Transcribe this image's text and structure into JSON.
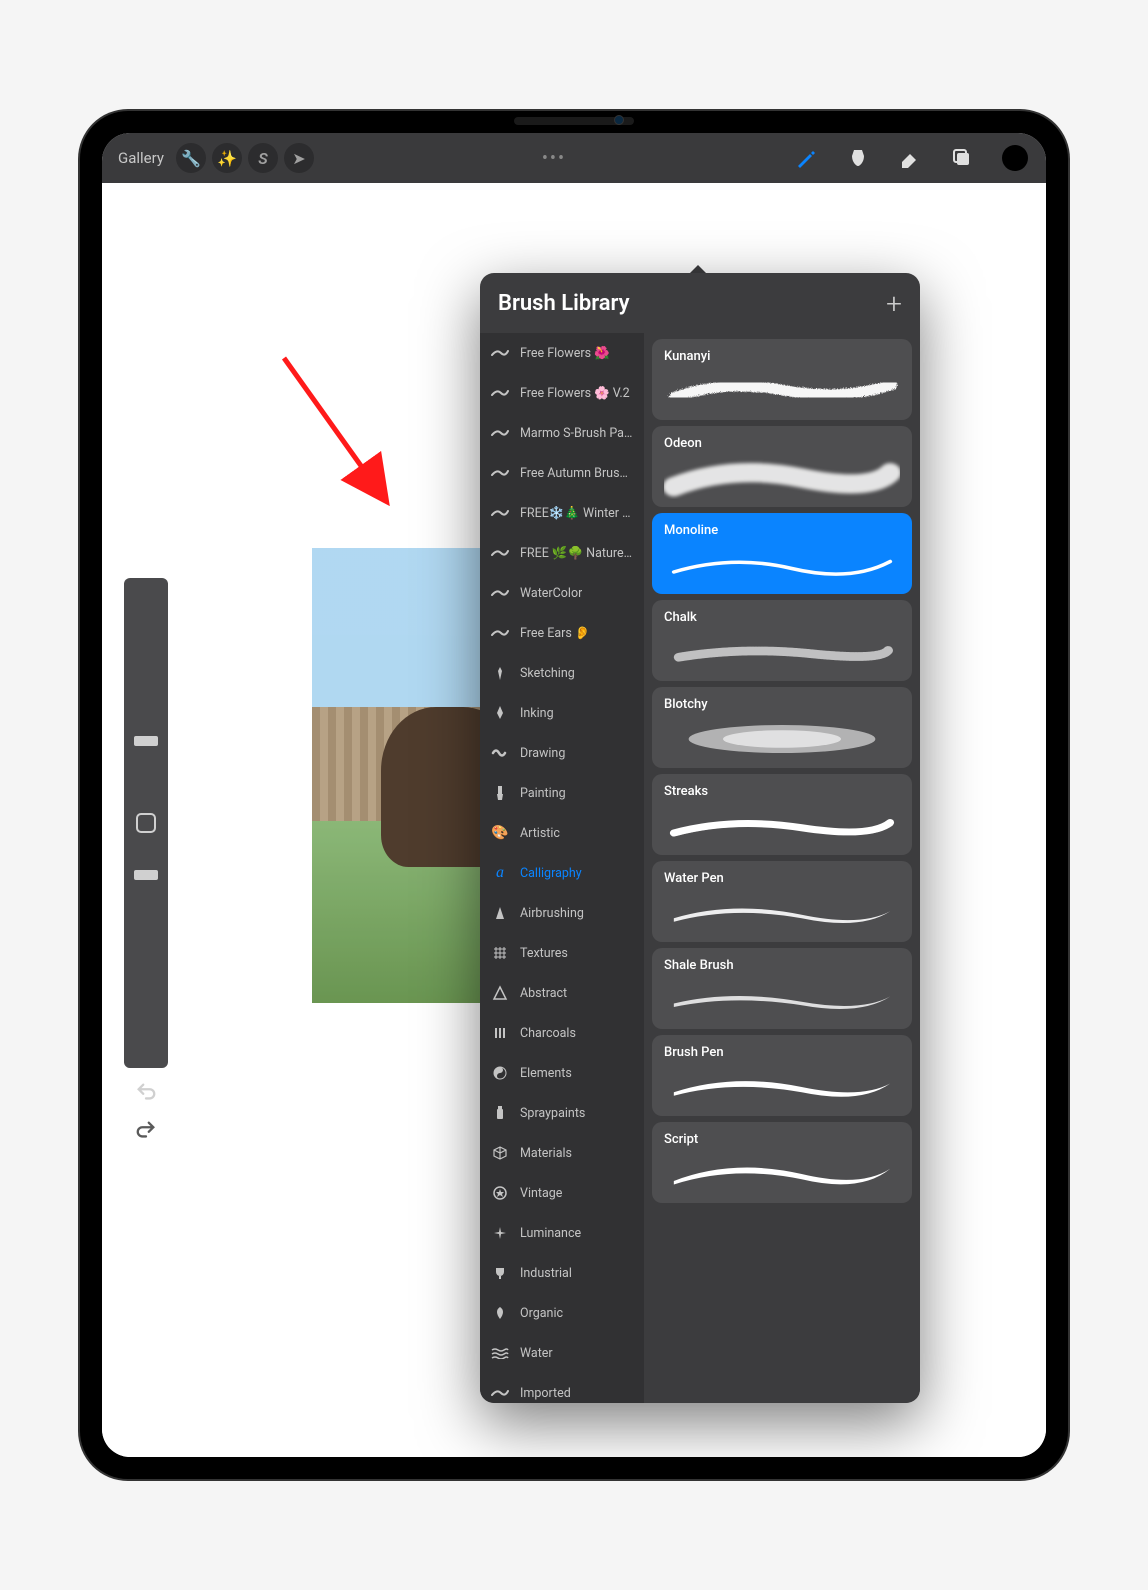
{
  "toolbar": {
    "gallery_label": "Gallery",
    "icons": [
      "wrench",
      "wand",
      "S",
      "arrow"
    ],
    "tools": [
      "brush",
      "smudge",
      "eraser",
      "layers"
    ],
    "active_tool": "brush"
  },
  "popover": {
    "title": "Brush Library",
    "categories": [
      {
        "label": "Free Flowers 🌺",
        "icon": "stroke"
      },
      {
        "label": "Free Flowers 🌸 V.2",
        "icon": "stroke"
      },
      {
        "label": "Marmo S-Brush Pack",
        "icon": "stroke"
      },
      {
        "label": "Free Autumn Brushes...",
        "icon": "stroke"
      },
      {
        "label": "FREE❄️🎄 Winter N...",
        "icon": "stroke"
      },
      {
        "label": "FREE 🌿🌳 Nature ...",
        "icon": "stroke"
      },
      {
        "label": "WaterColor",
        "icon": "stroke"
      },
      {
        "label": "Free Ears 👂",
        "icon": "stroke"
      },
      {
        "label": "Sketching",
        "icon": "pencil"
      },
      {
        "label": "Inking",
        "icon": "pen"
      },
      {
        "label": "Drawing",
        "icon": "squiggle"
      },
      {
        "label": "Painting",
        "icon": "paintbrush"
      },
      {
        "label": "Artistic",
        "icon": "palette"
      },
      {
        "label": "Calligraphy",
        "icon": "script",
        "selected": true
      },
      {
        "label": "Airbrushing",
        "icon": "spray"
      },
      {
        "label": "Textures",
        "icon": "hatch"
      },
      {
        "label": "Abstract",
        "icon": "triangle"
      },
      {
        "label": "Charcoals",
        "icon": "lines"
      },
      {
        "label": "Elements",
        "icon": "yinyang"
      },
      {
        "label": "Spraypaints",
        "icon": "can"
      },
      {
        "label": "Materials",
        "icon": "cube"
      },
      {
        "label": "Vintage",
        "icon": "star"
      },
      {
        "label": "Luminance",
        "icon": "sparkle"
      },
      {
        "label": "Industrial",
        "icon": "trophy"
      },
      {
        "label": "Organic",
        "icon": "leaf"
      },
      {
        "label": "Water",
        "icon": "waves"
      },
      {
        "label": "Imported",
        "icon": "stroke"
      }
    ],
    "brushes": [
      {
        "name": "Kunanyi",
        "style": "rough"
      },
      {
        "name": "Odeon",
        "style": "soft"
      },
      {
        "name": "Monoline",
        "style": "line",
        "selected": true
      },
      {
        "name": "Chalk",
        "style": "chalk"
      },
      {
        "name": "Blotchy",
        "style": "blot"
      },
      {
        "name": "Streaks",
        "style": "streak"
      },
      {
        "name": "Water Pen",
        "style": "water"
      },
      {
        "name": "Shale Brush",
        "style": "shale"
      },
      {
        "name": "Brush Pen",
        "style": "brushpen"
      },
      {
        "name": "Script",
        "style": "script"
      }
    ]
  }
}
